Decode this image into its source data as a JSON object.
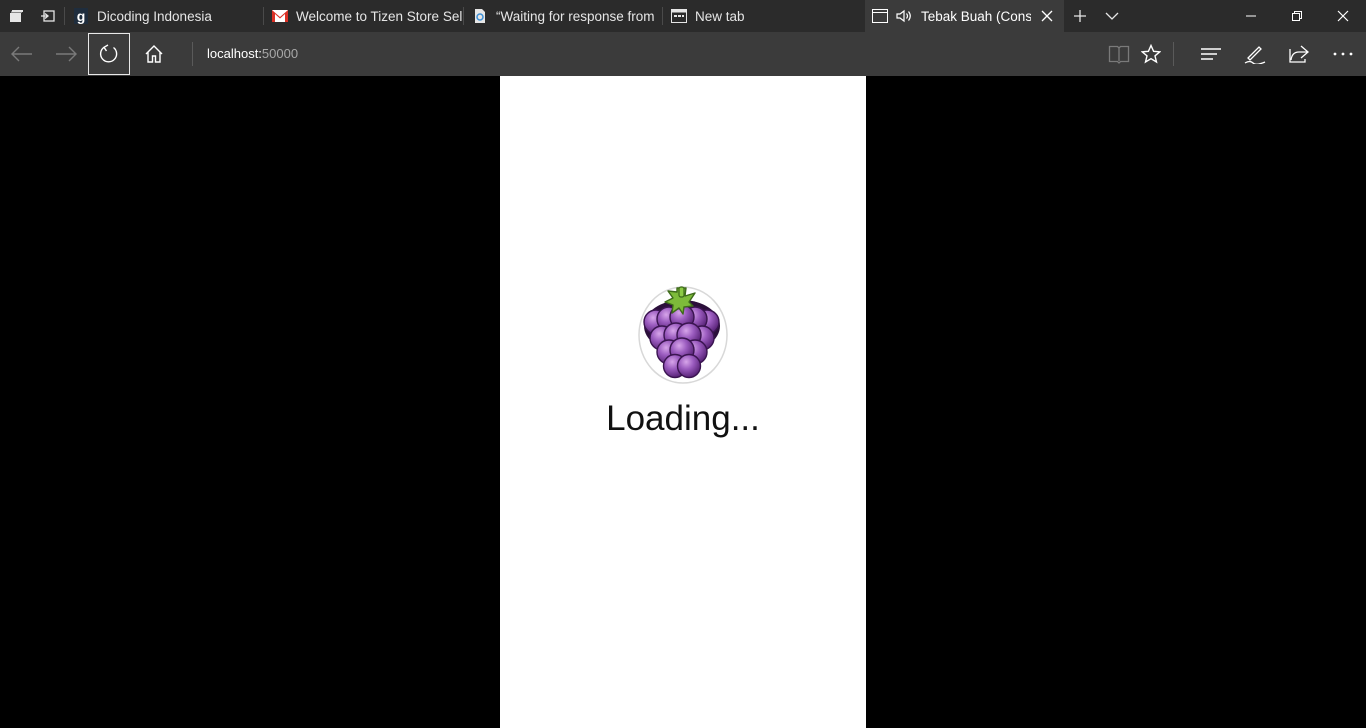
{
  "browser": {
    "tabs": [
      {
        "title": "Dicoding Indonesia",
        "icon": "dicoding-logo-icon"
      },
      {
        "title": "Welcome to Tizen Store Sell",
        "icon": "gmail-icon"
      },
      {
        "title": "“Waiting for response from",
        "icon": "page-loading-icon"
      },
      {
        "title": "New tab",
        "icon": "new-tab-icon"
      },
      {
        "title": "Tebak Buah (Constr",
        "icon": "page-icon",
        "active": true,
        "audio": true
      }
    ],
    "address": {
      "host": "localhost:",
      "port": "50000"
    },
    "colors": {
      "tabbar": "#2b2b2b",
      "toolbar": "#3b3b3b",
      "text": "#e6e6e6"
    }
  },
  "app": {
    "loading_text": "Loading...",
    "logo_icon": "grapes-icon",
    "background": "#ffffff"
  }
}
